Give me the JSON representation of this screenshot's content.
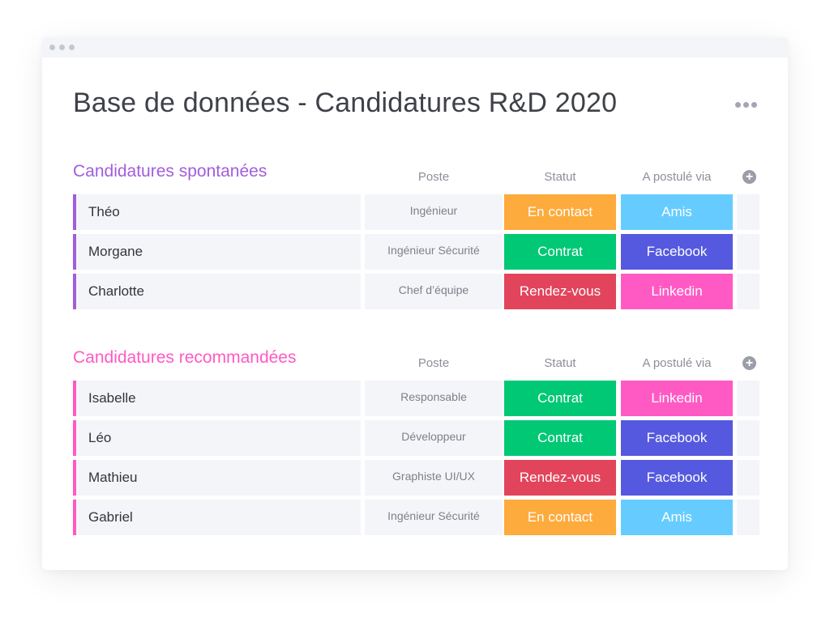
{
  "window": {
    "title": "Base de données - Candidatures R&D 2020",
    "more_icon": "more-horizontal-icon"
  },
  "columns": {
    "poste": "Poste",
    "statut": "Statut",
    "via": "A postulé via",
    "add_icon": "plus-circle-icon"
  },
  "colors": {
    "spontanees": "#a25ddc",
    "recommandees": "#ff5ac4",
    "en_contact": "#fdab3d",
    "contrat": "#00c875",
    "rendez_vous": "#e2445c",
    "amis": "#66ccff",
    "facebook": "#5559df",
    "linkedin": "#ff5ac4"
  },
  "groups": [
    {
      "title": "Candidatures spontanées",
      "color": "#a25ddc",
      "rows": [
        {
          "name": "Théo",
          "poste": "Ingénieur",
          "statut": "En contact",
          "statut_color": "#fdab3d",
          "via": "Amis",
          "via_color": "#66ccff"
        },
        {
          "name": "Morgane",
          "poste": "Ingénieur Sécurité",
          "statut": "Contrat",
          "statut_color": "#00c875",
          "via": "Facebook",
          "via_color": "#5559df"
        },
        {
          "name": "Charlotte",
          "poste": "Chef d’équipe",
          "statut": "Rendez-vous",
          "statut_color": "#e2445c",
          "via": "Linkedin",
          "via_color": "#ff5ac4"
        }
      ]
    },
    {
      "title": "Candidatures recommandées",
      "color": "#ff5ac4",
      "rows": [
        {
          "name": "Isabelle",
          "poste": "Responsable",
          "statut": "Contrat",
          "statut_color": "#00c875",
          "via": "Linkedin",
          "via_color": "#ff5ac4"
        },
        {
          "name": "Léo",
          "poste": "Développeur",
          "statut": "Contrat",
          "statut_color": "#00c875",
          "via": "Facebook",
          "via_color": "#5559df"
        },
        {
          "name": "Mathieu",
          "poste": "Graphiste UI/UX",
          "statut": "Rendez-vous",
          "statut_color": "#e2445c",
          "via": "Facebook",
          "via_color": "#5559df"
        },
        {
          "name": "Gabriel",
          "poste": "Ingénieur Sécurité",
          "statut": "En contact",
          "statut_color": "#fdab3d",
          "via": "Amis",
          "via_color": "#66ccff"
        }
      ]
    }
  ]
}
